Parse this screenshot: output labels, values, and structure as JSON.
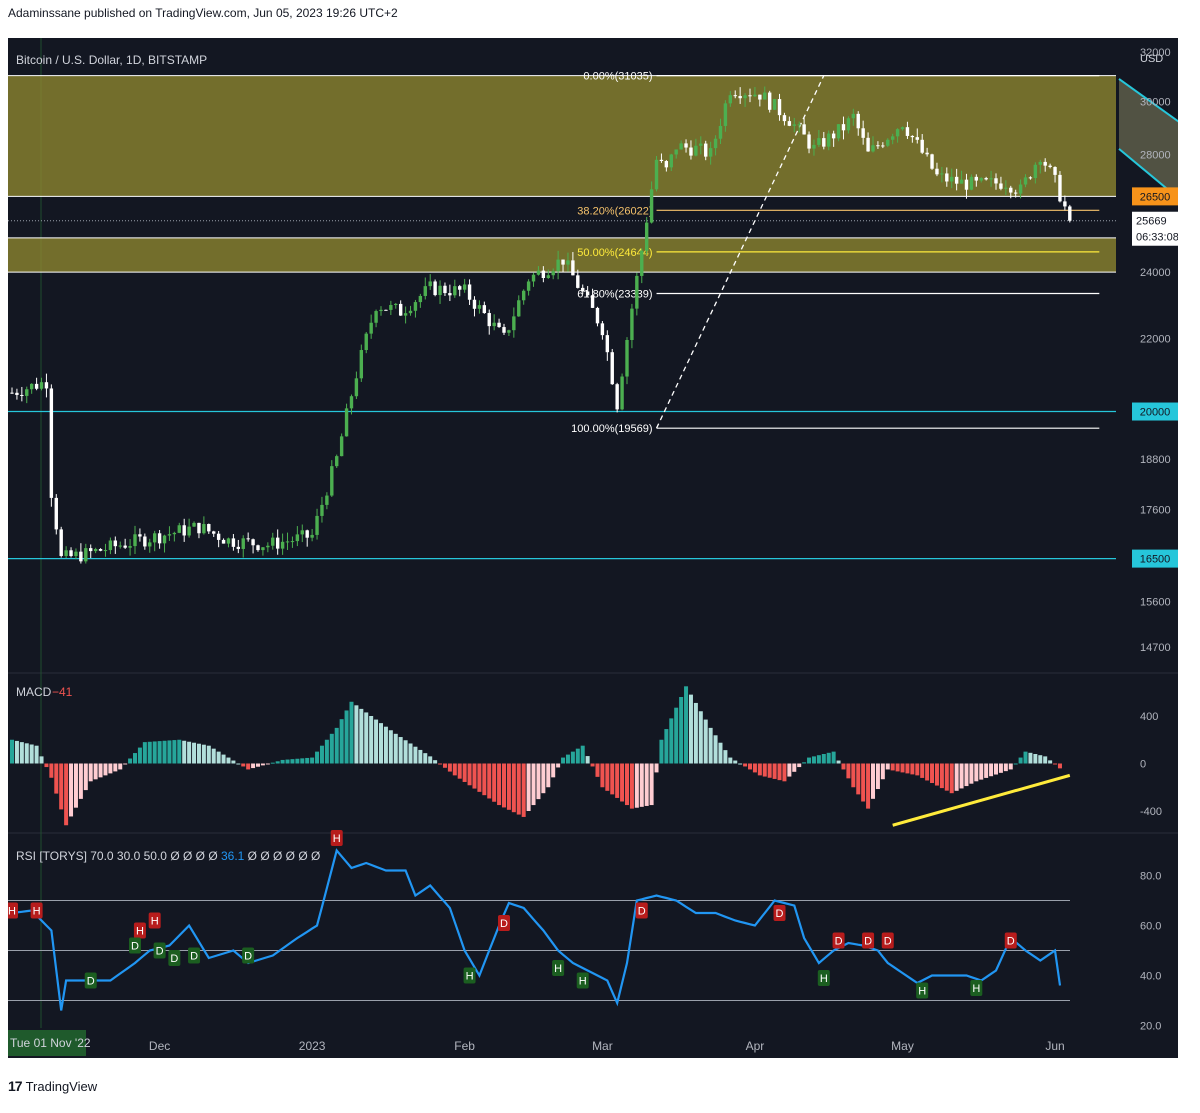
{
  "header": {
    "published": "Adaminssane published on TradingView.com, Jun 05, 2023 19:26 UTC+2"
  },
  "footer": {
    "brand": "TradingView",
    "logo_icon": "tradingview-logo-icon"
  },
  "colors": {
    "bg": "#131722",
    "up": "#4caf50",
    "down": "#ffffff",
    "zone": "#8c8530",
    "cyan": "#26c6da",
    "orange": "#f7931a",
    "rsi": "#2196f3",
    "macd_pos": "#26a69a",
    "macd_pos_light": "#b2dfdb",
    "macd_neg": "#ef5350",
    "macd_neg_light": "#ffcdd2",
    "trend": "#ffeb3b",
    "divider": "#2a2e39"
  },
  "chart_data": [
    {
      "type": "candlestick",
      "title": "Bitcoin / U.S. Dollar, 1D, BITSTAMP",
      "currency": "USD",
      "y_ticks": [
        32000,
        30000,
        28000,
        26500,
        25669,
        24000,
        22000,
        20000,
        18800,
        17600,
        16500,
        15600,
        14700
      ],
      "price_labels": {
        "last": "25669",
        "countdown": "06:33:08",
        "level_26500": "26500",
        "level_20000": "20000",
        "level_16500": "16500"
      },
      "x_labels": [
        "Tue 01 Nov '22",
        "Dec",
        "2023",
        "Feb",
        "Mar",
        "Apr",
        "May",
        "Jun"
      ],
      "x_label_days": [
        0,
        30,
        61,
        92,
        120,
        151,
        181,
        212
      ],
      "ylim_log": [
        14300,
        32600
      ],
      "fib_levels": [
        {
          "label": "0.00%(31035)",
          "price": 31035
        },
        {
          "label": "38.20%(26022)",
          "price": 26022
        },
        {
          "label": "50.00%(24644)",
          "price": 24644
        },
        {
          "label": "61.80%(23339)",
          "price": 23339
        },
        {
          "label": "100.00%(19569)",
          "price": 19569
        }
      ],
      "horizontal_levels": [
        26500,
        20000,
        16500
      ],
      "zones": [
        {
          "from": 26500,
          "to": 31035
        },
        {
          "from": 24000,
          "to": 25100
        }
      ],
      "channel": {
        "upper": [
          [
            225,
            30900
          ],
          [
            246,
            28050
          ]
        ],
        "lower": [
          [
            225,
            28200
          ],
          [
            246,
            25200
          ]
        ]
      },
      "close_series": {
        "days": [
          0,
          7,
          8,
          10,
          15,
          22,
          30,
          38,
          44,
          52,
          61,
          66,
          70,
          74,
          79,
          85,
          92,
          100,
          105,
          112,
          115,
          120,
          123,
          128,
          131,
          133,
          135,
          139,
          142,
          146,
          152,
          158,
          163,
          169,
          171,
          174,
          181,
          188,
          192,
          196,
          202,
          205,
          209,
          212,
          215
        ],
        "values": [
          20500,
          20800,
          18000,
          16500,
          16600,
          16800,
          17000,
          17200,
          16900,
          16800,
          17000,
          18800,
          21000,
          23000,
          22800,
          23500,
          23400,
          22000,
          23800,
          24400,
          23600,
          22300,
          20200,
          24700,
          27800,
          27400,
          28300,
          28200,
          28000,
          30500,
          30300,
          29300,
          28200,
          29000,
          29400,
          28000,
          29200,
          27200,
          27000,
          26900,
          27000,
          26700,
          28000,
          27000,
          25669
        ]
      }
    },
    {
      "type": "bar",
      "title": "MACD",
      "value_label": "−41",
      "y_ticks": [
        400,
        0,
        -400
      ],
      "ylim": [
        -560,
        720
      ],
      "key_points": [
        [
          0,
          200
        ],
        [
          5,
          150
        ],
        [
          8,
          -120
        ],
        [
          11,
          -520
        ],
        [
          16,
          -150
        ],
        [
          22,
          -50
        ],
        [
          27,
          180
        ],
        [
          34,
          200
        ],
        [
          40,
          150
        ],
        [
          48,
          -50
        ],
        [
          55,
          30
        ],
        [
          61,
          50
        ],
        [
          66,
          300
        ],
        [
          69,
          520
        ],
        [
          73,
          400
        ],
        [
          78,
          250
        ],
        [
          85,
          60
        ],
        [
          90,
          -100
        ],
        [
          99,
          -350
        ],
        [
          104,
          -450
        ],
        [
          109,
          -200
        ],
        [
          112,
          50
        ],
        [
          116,
          150
        ],
        [
          120,
          -200
        ],
        [
          126,
          -380
        ],
        [
          130,
          -350
        ],
        [
          132,
          200
        ],
        [
          137,
          650
        ],
        [
          142,
          300
        ],
        [
          146,
          50
        ],
        [
          152,
          -100
        ],
        [
          157,
          -150
        ],
        [
          162,
          50
        ],
        [
          167,
          100
        ],
        [
          171,
          -200
        ],
        [
          174,
          -380
        ],
        [
          178,
          -50
        ],
        [
          184,
          -100
        ],
        [
          191,
          -250
        ],
        [
          196,
          -150
        ],
        [
          203,
          -50
        ],
        [
          206,
          100
        ],
        [
          210,
          60
        ],
        [
          213,
          -41
        ]
      ],
      "trendline": [
        [
          179,
          -520
        ],
        [
          215,
          -100
        ]
      ]
    },
    {
      "type": "line",
      "title": "RSI [TORYS]",
      "params": "70.0  30.0  50.0  Ø  Ø  Ø  Ø",
      "value_label": "36.1",
      "params_tail": "Ø  Ø  Ø  Ø  Ø  Ø",
      "y_ticks": [
        80.0,
        60.0,
        40.0,
        20.0
      ],
      "ylim": [
        17,
        95
      ],
      "guides": [
        70,
        50,
        30
      ],
      "key_points": [
        [
          0,
          65
        ],
        [
          4,
          66
        ],
        [
          8,
          58
        ],
        [
          10,
          26
        ],
        [
          11,
          38
        ],
        [
          15,
          38
        ],
        [
          20,
          38
        ],
        [
          25,
          45
        ],
        [
          28,
          50
        ],
        [
          32,
          52
        ],
        [
          36,
          60
        ],
        [
          40,
          47
        ],
        [
          45,
          50
        ],
        [
          48,
          45
        ],
        [
          53,
          48
        ],
        [
          58,
          55
        ],
        [
          62,
          60
        ],
        [
          66,
          90
        ],
        [
          69,
          83
        ],
        [
          72,
          85
        ],
        [
          76,
          82
        ],
        [
          80,
          82
        ],
        [
          82,
          72
        ],
        [
          85,
          76
        ],
        [
          89,
          67
        ],
        [
          92,
          50
        ],
        [
          95,
          40
        ],
        [
          99,
          60
        ],
        [
          101,
          69
        ],
        [
          104,
          67
        ],
        [
          108,
          58
        ],
        [
          111,
          50
        ],
        [
          114,
          45
        ],
        [
          117,
          42
        ],
        [
          121,
          38
        ],
        [
          123,
          29
        ],
        [
          125,
          45
        ],
        [
          127,
          70
        ],
        [
          131,
          72
        ],
        [
          135,
          70
        ],
        [
          139,
          65
        ],
        [
          143,
          65
        ],
        [
          147,
          62
        ],
        [
          151,
          60
        ],
        [
          155,
          70
        ],
        [
          159,
          68
        ],
        [
          161,
          55
        ],
        [
          164,
          45
        ],
        [
          167,
          50
        ],
        [
          170,
          53
        ],
        [
          173,
          52
        ],
        [
          176,
          50
        ],
        [
          178,
          45
        ],
        [
          181,
          41
        ],
        [
          184,
          37
        ],
        [
          187,
          40
        ],
        [
          190,
          40
        ],
        [
          194,
          40
        ],
        [
          197,
          38
        ],
        [
          200,
          42
        ],
        [
          203,
          55
        ],
        [
          206,
          50
        ],
        [
          209,
          46
        ],
        [
          212,
          50
        ],
        [
          213,
          36
        ]
      ],
      "markers": [
        {
          "t": "H",
          "d": 0,
          "v": 66,
          "c": "red"
        },
        {
          "t": "H",
          "d": 5,
          "v": 66,
          "c": "red"
        },
        {
          "t": "D",
          "d": 16,
          "v": 38,
          "c": "green"
        },
        {
          "t": "H",
          "d": 26,
          "v": 58,
          "c": "red"
        },
        {
          "t": "D",
          "d": 25,
          "v": 52,
          "c": "green"
        },
        {
          "t": "H",
          "d": 29,
          "v": 62,
          "c": "red"
        },
        {
          "t": "D",
          "d": 30,
          "v": 50,
          "c": "green"
        },
        {
          "t": "D",
          "d": 33,
          "v": 47,
          "c": "green"
        },
        {
          "t": "D",
          "d": 37,
          "v": 48,
          "c": "green"
        },
        {
          "t": "D",
          "d": 48,
          "v": 48,
          "c": "green"
        },
        {
          "t": "H",
          "d": 66,
          "v": 95,
          "c": "red"
        },
        {
          "t": "H",
          "d": 93,
          "v": 40,
          "c": "green"
        },
        {
          "t": "D",
          "d": 100,
          "v": 61,
          "c": "red"
        },
        {
          "t": "H",
          "d": 111,
          "v": 43,
          "c": "green"
        },
        {
          "t": "H",
          "d": 116,
          "v": 38,
          "c": "green"
        },
        {
          "t": "D",
          "d": 128,
          "v": 66,
          "c": "red"
        },
        {
          "t": "D",
          "d": 156,
          "v": 65,
          "c": "red"
        },
        {
          "t": "H",
          "d": 165,
          "v": 39,
          "c": "green"
        },
        {
          "t": "D",
          "d": 168,
          "v": 54,
          "c": "red"
        },
        {
          "t": "D",
          "d": 174,
          "v": 54,
          "c": "red"
        },
        {
          "t": "D",
          "d": 178,
          "v": 54,
          "c": "red"
        },
        {
          "t": "H",
          "d": 185,
          "v": 34,
          "c": "green"
        },
        {
          "t": "H",
          "d": 196,
          "v": 35,
          "c": "green"
        },
        {
          "t": "D",
          "d": 203,
          "v": 54,
          "c": "red"
        }
      ]
    }
  ]
}
